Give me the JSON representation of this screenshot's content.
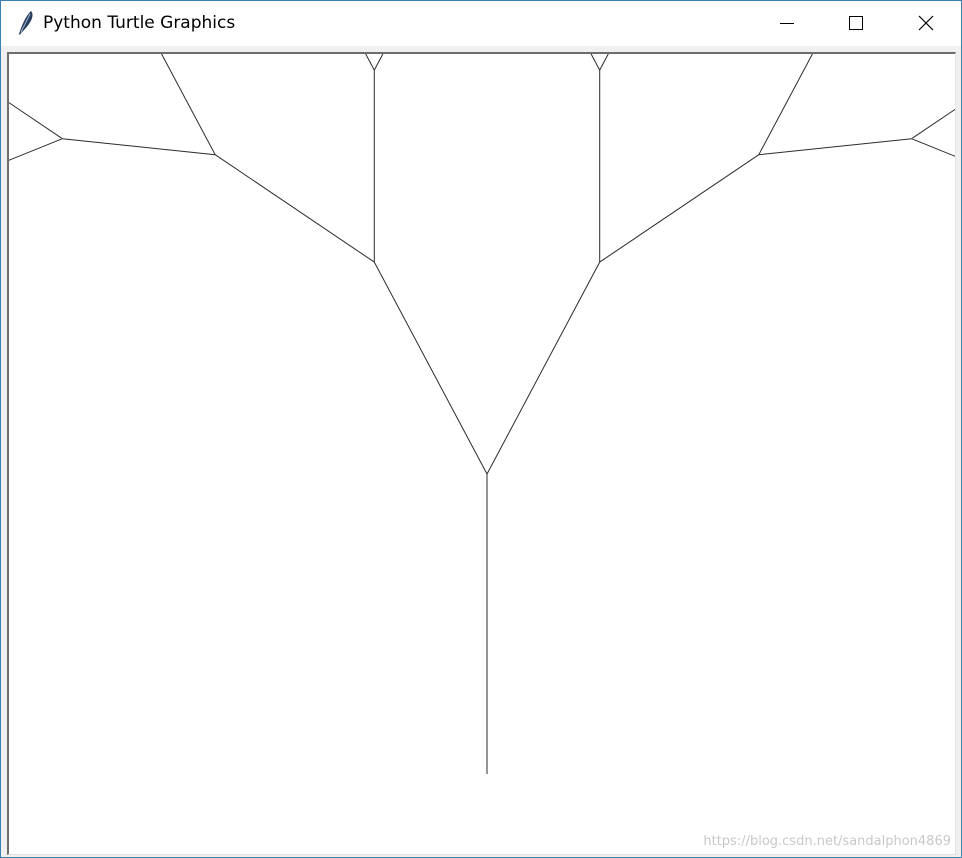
{
  "window": {
    "title": "Python Turtle Graphics",
    "icon": "feather-icon",
    "accent_border": "#3c7fb1",
    "controls": {
      "minimize": "minimize-icon",
      "maximize": "maximize-icon",
      "close": "close-icon"
    }
  },
  "canvas": {
    "background": "#ffffff",
    "pen_color": "#2b2b2b",
    "drawing": "fractal tree",
    "tree": {
      "depth": 9,
      "branch_angle_deg": 56,
      "length_ratio": 0.8
    }
  },
  "watermark": "https://blog.csdn.net/sandalphon4869"
}
